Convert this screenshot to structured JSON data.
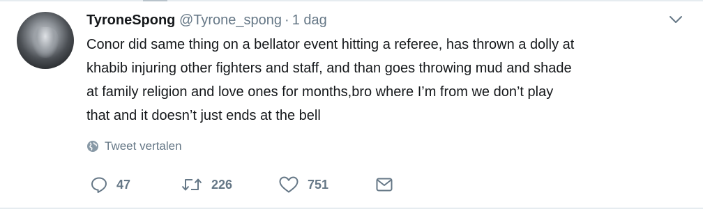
{
  "tweet": {
    "display_name": "TyroneSpong",
    "handle": "@Tyrone_spong",
    "separator": "·",
    "timestamp": "1 dag",
    "lines": [
      "Conor did same thing on a bellator event hitting a referee, has thrown a dolly at",
      "khabib injuring other fighters and staff, and than goes throwing mud and shade",
      "at family religion and love ones for months,bro where I’m from we don’t play",
      "that and it doesn’t just ends at the bell"
    ],
    "translate_label": "Tweet vertalen"
  },
  "actions": {
    "reply_icon": "reply-icon",
    "reply_count": "47",
    "retweet_icon": "retweet-icon",
    "retweet_count": "226",
    "like_icon": "heart-icon",
    "like_count": "751",
    "dm_icon": "envelope-icon"
  },
  "colors": {
    "text": "#14171a",
    "secondary": "#657786",
    "background": "#ffffff",
    "divider": "#e6ecf0"
  }
}
